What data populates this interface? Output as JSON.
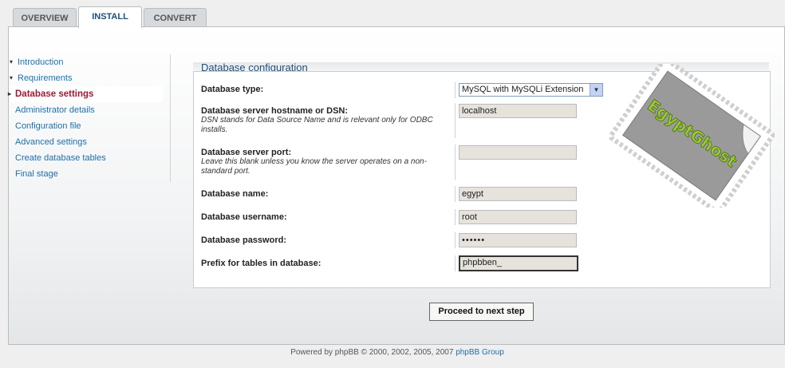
{
  "tabs": [
    {
      "label": "OVERVIEW",
      "active": false
    },
    {
      "label": "INSTALL",
      "active": true
    },
    {
      "label": "CONVERT",
      "active": false
    }
  ],
  "menu": {
    "items": [
      {
        "label": "Introduction",
        "state": "done"
      },
      {
        "label": "Requirements",
        "state": "done"
      },
      {
        "label": "Database settings",
        "state": "current"
      },
      {
        "label": "Administrator details",
        "state": "todo"
      },
      {
        "label": "Configuration file",
        "state": "todo"
      },
      {
        "label": "Advanced settings",
        "state": "todo"
      },
      {
        "label": "Create database tables",
        "state": "todo"
      },
      {
        "label": "Final stage",
        "state": "todo"
      }
    ]
  },
  "config": {
    "title": "Database configuration",
    "db_type_label": "Database type:",
    "db_type_value": "MySQL with MySQLi Extension",
    "hostname_label": "Database server hostname or DSN:",
    "hostname_hint": "DSN stands for Data Source Name and is relevant only for ODBC installs.",
    "hostname_value": "localhost",
    "port_label": "Database server port:",
    "port_hint": "Leave this blank unless you know the server operates on a non-standard port.",
    "port_value": "",
    "name_label": "Database name:",
    "name_value": "egypt",
    "username_label": "Database username:",
    "username_value": "root",
    "password_label": "Database password:",
    "password_value": "••••••",
    "prefix_label": "Prefix for tables in database:",
    "prefix_value": "phpbben_"
  },
  "stamp_text": "EgyptGhost",
  "proceed_label": "Proceed to next step",
  "footer": {
    "text": "Powered by phpBB © 2000, 2002, 2005, 2007",
    "link": "phpBB Group"
  },
  "colors": {
    "accent_blue": "#1f4f7a",
    "link_blue": "#1f6fa8",
    "current_red": "#9c1a35",
    "stamp_green": "#9acd32"
  }
}
